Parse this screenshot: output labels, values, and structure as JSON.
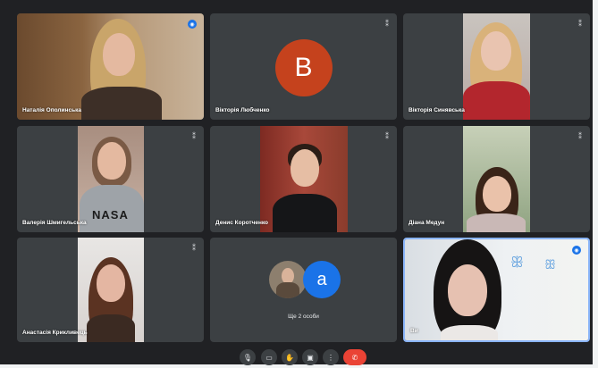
{
  "colors": {
    "background": "#202124",
    "tile": "#3c4043",
    "avatar_b": "#c5421d",
    "avatar_a": "#1a73e8",
    "end_call": "#ea4335",
    "active_border": "#8ab4f8"
  },
  "participants": [
    {
      "name": "Наталія Ополинська",
      "mic": "muted",
      "icon": "speaking-indicator-icon"
    },
    {
      "name": "Вікторія Любченко",
      "mic": "muted",
      "avatar_letter": "В"
    },
    {
      "name": "Вікторія Синявська",
      "mic": "muted"
    },
    {
      "name": "Валерія Шмигельська",
      "mic": "muted"
    },
    {
      "name": "Денис Коротченко",
      "mic": "muted"
    },
    {
      "name": "Діана Медун",
      "mic": "muted"
    },
    {
      "name": "Анастасія Крикливець",
      "mic": "muted"
    },
    {
      "name": "Ви",
      "mic": "on",
      "icon": "speaking-indicator-icon"
    }
  ],
  "others_tile": {
    "avatar_letter": "a",
    "label": "Ще 2 особи"
  },
  "controls": [
    {
      "name": "microphone",
      "glyph": "🎙"
    },
    {
      "name": "camera",
      "glyph": "▭"
    },
    {
      "name": "raise-hand",
      "glyph": "✋"
    },
    {
      "name": "present-screen",
      "glyph": "▣"
    },
    {
      "name": "more-options",
      "glyph": "⋮"
    },
    {
      "name": "end-call",
      "glyph": "✆"
    }
  ]
}
